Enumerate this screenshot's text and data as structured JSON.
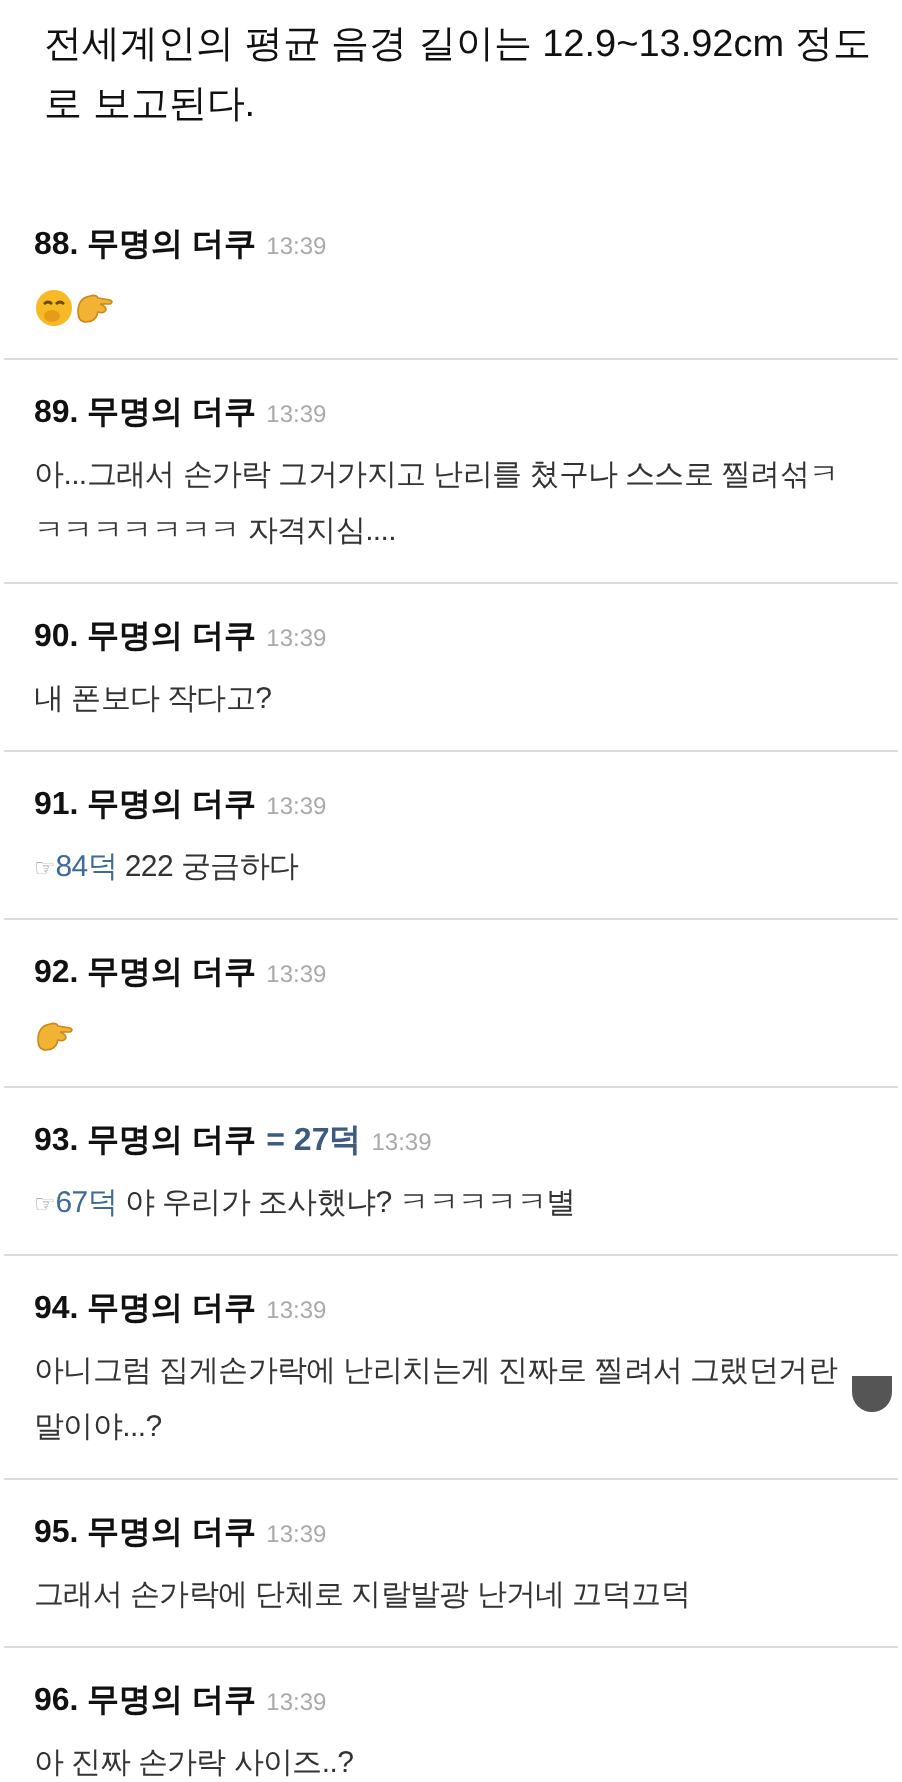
{
  "intro": {
    "lines": [
      "전세계인의 평균 음경 길이는 12.9~13.92cm 정도",
      "로 보고된다."
    ]
  },
  "comments": [
    {
      "number": "88.",
      "author": "무명의 더쿠",
      "time": "13:39",
      "body": {
        "kind": "emoji",
        "emojis": [
          {
            "kind": "face"
          },
          {
            "kind": "pinch"
          }
        ]
      }
    },
    {
      "number": "89.",
      "author": "무명의 더쿠",
      "time": "13:39",
      "body": {
        "kind": "text",
        "text": "아...그래서 손가락 그거가지고 난리를 쳤구나 스스로 찔려섞ㅋㅋㅋㅋㅋㅋㅋㅋ 자격지심...."
      }
    },
    {
      "number": "90.",
      "author": "무명의 더쿠",
      "time": "13:39",
      "body": {
        "kind": "text",
        "text": "내 폰보다 작다고?"
      }
    },
    {
      "number": "91.",
      "author": "무명의 더쿠",
      "time": "13:39",
      "body": {
        "kind": "text",
        "reply_mark": "☞",
        "reply_link": "84덕",
        "text": "222 궁금하다"
      }
    },
    {
      "number": "92.",
      "author": "무명의 더쿠",
      "time": "13:39",
      "body": {
        "kind": "emoji",
        "emojis": [
          {
            "kind": "pinch"
          }
        ]
      }
    },
    {
      "number": "93.",
      "author": "무명의 더쿠",
      "tag": "= 27덕",
      "time": "13:39",
      "body": {
        "kind": "text",
        "reply_mark": "☞",
        "reply_link": "67덕",
        "text": "야 우리가 조사했냐? ㅋㅋㅋㅋㅋ별"
      }
    },
    {
      "number": "94.",
      "author": "무명의 더쿠",
      "time": "13:39",
      "body": {
        "kind": "text",
        "text": "아니그럼 집게손가락에 난리치는게 진짜로 찔려서 그랬던거란 말이야...?"
      }
    },
    {
      "number": "95.",
      "author": "무명의 더쿠",
      "time": "13:39",
      "body": {
        "kind": "text",
        "text": "그래서 손가락에 단체로 지랄발광 난거네 끄덕끄덕"
      }
    },
    {
      "number": "96.",
      "author": "무명의 더쿠",
      "time": "13:39",
      "body": {
        "kind": "text",
        "text": "아 진짜 손가락 사이즈..?"
      }
    }
  ]
}
